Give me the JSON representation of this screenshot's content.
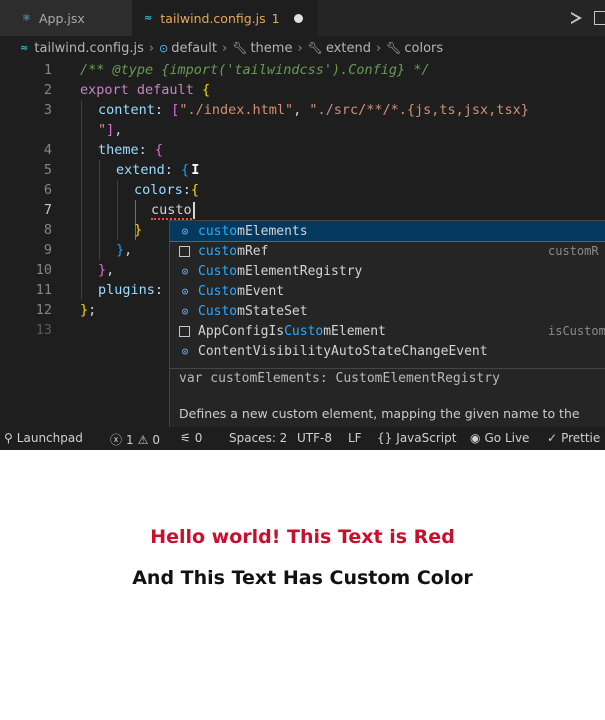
{
  "tabs": [
    {
      "label": "App.jsx",
      "icon": "react-icon"
    },
    {
      "label": "tailwind.config.js",
      "problems": "1",
      "icon": "tailwind-icon",
      "modified": true
    }
  ],
  "breadcrumb": [
    "tailwind.config.js",
    "default",
    "theme",
    "extend",
    "colors"
  ],
  "line_numbers": [
    "1",
    "2",
    "3",
    "4",
    "5",
    "6",
    "7",
    "8",
    "9",
    "10",
    "11",
    "12",
    "13"
  ],
  "code": {
    "l1_comment": "/** @type {import('tailwindcss').Config} */",
    "l2_export": "export",
    "l2_default": "default",
    "l3_key": "content",
    "l3_str1": "\"./index.html\"",
    "l3_str2": "\"./src/**/*.{js,ts,jsx,tsx}",
    "l3b_str": "\"",
    "l4_key": "theme",
    "l5_key": "extend",
    "l6_key": "colors",
    "l7_typed": "custo",
    "l11_key": "plugins"
  },
  "suggestions": [
    {
      "match": "custo",
      "rest": "mElements",
      "detail": "",
      "selected": true,
      "icon": "variable"
    },
    {
      "match": "custo",
      "rest": "mRef",
      "detail": "customR",
      "selected": false,
      "icon": "interface"
    },
    {
      "match": "Custo",
      "rest": "mElementRegistry",
      "detail": "",
      "selected": false,
      "icon": "variable"
    },
    {
      "match": "Custo",
      "rest": "mEvent",
      "detail": "",
      "selected": false,
      "icon": "variable"
    },
    {
      "match": "Custo",
      "rest": "mStateSet",
      "detail": "",
      "selected": false,
      "icon": "variable"
    },
    {
      "prefix": "AppConfigIs",
      "match": "Custo",
      "rest": "mElement",
      "detail": "isCustomElemen",
      "selected": false,
      "icon": "interface"
    },
    {
      "prefix": "ContentVisibilityAutoStateChangeEvent",
      "match": "",
      "rest": "",
      "detail": "",
      "selected": false,
      "icon": "variable"
    }
  ],
  "suggest_signature": "var customElements: CustomElementRegistry",
  "suggest_doc": "Defines a new custom element, mapping the given name to the",
  "statusbar": {
    "launchpad": "Launchpad",
    "errors": "1",
    "warnings": "0",
    "ports": "0",
    "spaces": "Spaces: 2",
    "encoding": "UTF-8",
    "eol": "LF",
    "language": "JavaScript",
    "golive": "Go Live",
    "prettier": "Prettie"
  },
  "preview": {
    "red_text": "Hello world! This Text is Red",
    "custom_text": "And This Text Has Custom Color",
    "red_color": "#c8102e"
  }
}
